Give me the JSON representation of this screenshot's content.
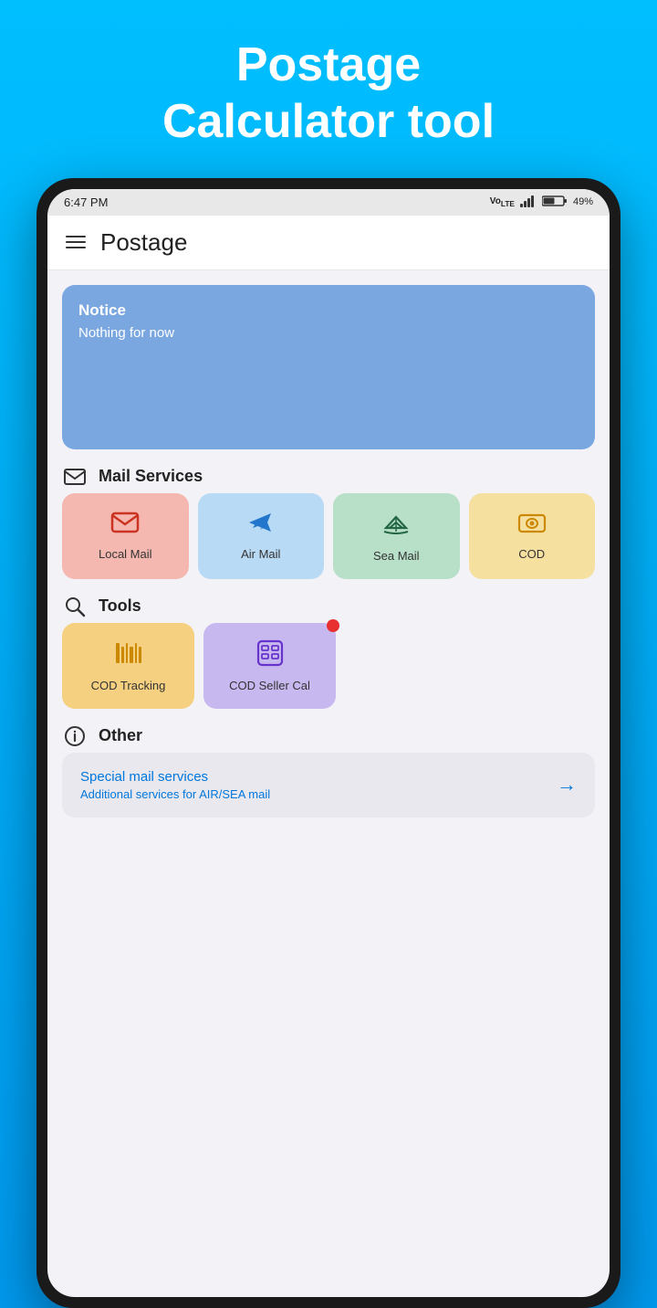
{
  "hero": {
    "title": "Postage\nCalculator tool"
  },
  "statusBar": {
    "time": "6:47 PM",
    "battery": "49%",
    "signal": "▂▄▆"
  },
  "header": {
    "title": "Postage"
  },
  "notice": {
    "title": "Notice",
    "body": "Nothing for now"
  },
  "mailServices": {
    "sectionLabel": "Mail Services",
    "items": [
      {
        "id": "local-mail",
        "label": "Local Mail"
      },
      {
        "id": "air-mail",
        "label": "Air Mail"
      },
      {
        "id": "sea-mail",
        "label": "Sea Mail"
      },
      {
        "id": "cod",
        "label": "COD"
      }
    ]
  },
  "tools": {
    "sectionLabel": "Tools",
    "items": [
      {
        "id": "cod-tracking",
        "label": "COD\nTracking",
        "badge": true
      },
      {
        "id": "cod-seller",
        "label": "COD Seller\nCal",
        "badge": false
      }
    ]
  },
  "other": {
    "sectionLabel": "Other",
    "card": {
      "title": "Special mail services",
      "subtitle": "Additional services for AIR/SEA mail"
    }
  },
  "icons": {
    "mail": "✉",
    "search": "🔍",
    "info": "ℹ"
  }
}
